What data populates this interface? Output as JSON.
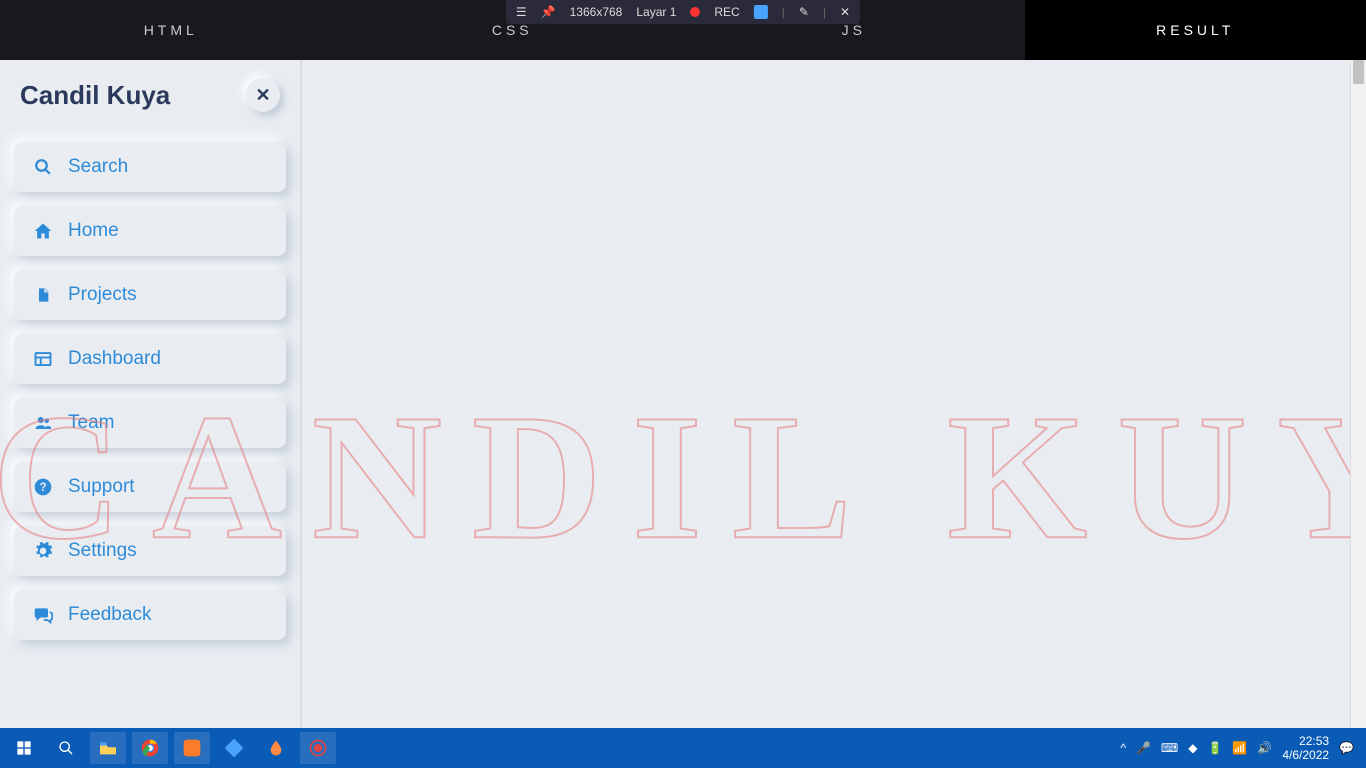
{
  "recorder": {
    "resolution": "1366x768",
    "layer_label": "Layar 1",
    "rec_label": "REC"
  },
  "editor_tabs": {
    "html": "HTML",
    "css": "CSS",
    "js": "JS",
    "result": "RESULT"
  },
  "sidebar": {
    "brand": "Candil Kuya",
    "close": "✕",
    "items": [
      {
        "label": "Search",
        "icon": "search-icon"
      },
      {
        "label": "Home",
        "icon": "home-icon"
      },
      {
        "label": "Projects",
        "icon": "file-icon"
      },
      {
        "label": "Dashboard",
        "icon": "dashboard-icon"
      },
      {
        "label": "Team",
        "icon": "team-icon"
      },
      {
        "label": "Support",
        "icon": "support-icon"
      },
      {
        "label": "Settings",
        "icon": "gear-icon"
      },
      {
        "label": "Feedback",
        "icon": "chat-icon"
      }
    ]
  },
  "watermark_text": "CANDIL  KUYA",
  "taskbar": {
    "time": "22:53",
    "date": "4/6/2022"
  }
}
